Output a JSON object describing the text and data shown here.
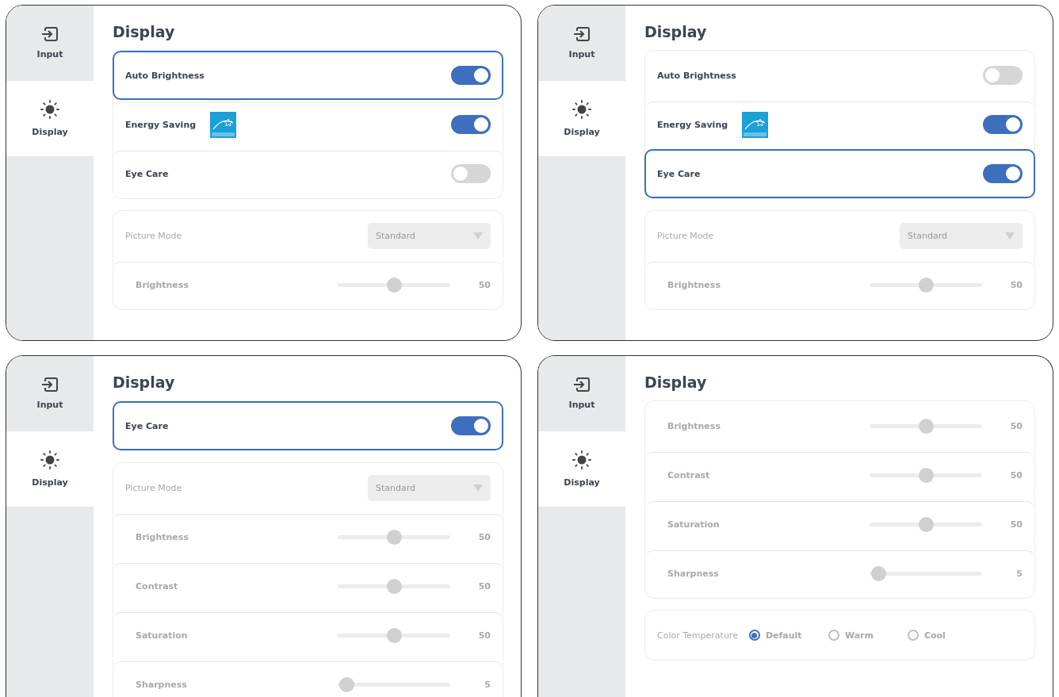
{
  "panels": [
    {
      "sidebar": [
        {
          "kind": "input",
          "label": "Input",
          "selected": false
        },
        {
          "kind": "display",
          "label": "Display",
          "selected": true
        }
      ],
      "title": "Display",
      "sections": [
        {
          "rows": [
            {
              "kind": "toggle",
              "label": "Auto Brightness",
              "on": true,
              "focused": true
            },
            {
              "kind": "toggle",
              "label": "Energy Saving",
              "on": true,
              "focused": false,
              "logo": true
            },
            {
              "kind": "toggle",
              "label": "Eye Care",
              "on": false,
              "focused": false
            }
          ]
        },
        {
          "rows": [
            {
              "kind": "dropdown",
              "label": "Picture Mode",
              "value": "Standard",
              "disabled": true
            },
            {
              "kind": "slider",
              "label": "Brightness",
              "level": 0.5,
              "reading": "50",
              "disabled": true
            }
          ]
        }
      ]
    },
    {
      "sidebar": [
        {
          "kind": "input",
          "label": "Input",
          "selected": false
        },
        {
          "kind": "display",
          "label": "Display",
          "selected": true
        }
      ],
      "title": "Display",
      "sections": [
        {
          "rows": [
            {
              "kind": "toggle",
              "label": "Auto Brightness",
              "on": false,
              "focused": false
            },
            {
              "kind": "toggle",
              "label": "Energy Saving",
              "on": true,
              "focused": false,
              "logo": true
            },
            {
              "kind": "toggle",
              "label": "Eye Care",
              "on": true,
              "focused": true
            }
          ]
        },
        {
          "rows": [
            {
              "kind": "dropdown",
              "label": "Picture Mode",
              "value": "Standard",
              "disabled": true
            },
            {
              "kind": "slider",
              "label": "Brightness",
              "level": 0.5,
              "reading": "50",
              "disabled": true
            }
          ]
        }
      ]
    },
    {
      "sidebar": [
        {
          "kind": "input",
          "label": "Input",
          "selected": false
        },
        {
          "kind": "display",
          "label": "Display",
          "selected": true
        }
      ],
      "title": "Display",
      "sections": [
        {
          "rows": [
            {
              "kind": "toggle",
              "label": "Eye Care",
              "on": true,
              "focused": true
            }
          ]
        },
        {
          "rows": [
            {
              "kind": "dropdown",
              "label": "Picture Mode",
              "value": "Standard",
              "disabled": true
            },
            {
              "kind": "slider",
              "label": "Brightness",
              "level": 0.5,
              "reading": "50",
              "disabled": true
            },
            {
              "kind": "slider",
              "label": "Contrast",
              "level": 0.5,
              "reading": "50",
              "disabled": true
            },
            {
              "kind": "slider",
              "label": "Saturation",
              "level": 0.5,
              "reading": "50",
              "disabled": true
            },
            {
              "kind": "slider",
              "label": "Sharpness",
              "level": 0.05,
              "reading": "5",
              "disabled": true
            }
          ]
        }
      ]
    },
    {
      "sidebar": [
        {
          "kind": "input",
          "label": "Input",
          "selected": false
        },
        {
          "kind": "display",
          "label": "Display",
          "selected": true
        }
      ],
      "title": "Display",
      "sections": [
        {
          "rows": [
            {
              "kind": "slider",
              "label": "Brightness",
              "level": 0.5,
              "reading": "50",
              "disabled": true
            },
            {
              "kind": "slider",
              "label": "Contrast",
              "level": 0.5,
              "reading": "50",
              "disabled": true
            },
            {
              "kind": "slider",
              "label": "Saturation",
              "level": 0.5,
              "reading": "50",
              "disabled": true
            },
            {
              "kind": "slider",
              "label": "Sharpness",
              "level": 0.05,
              "reading": "5",
              "disabled": true
            }
          ]
        },
        {
          "rows": [
            {
              "kind": "radio",
              "label": "Color Temperature",
              "disabled": true,
              "options": [
                {
                  "label": "Default",
                  "selected": true
                },
                {
                  "label": "Warm",
                  "selected": false
                },
                {
                  "label": "Cool",
                  "selected": false
                }
              ]
            }
          ]
        }
      ]
    }
  ]
}
